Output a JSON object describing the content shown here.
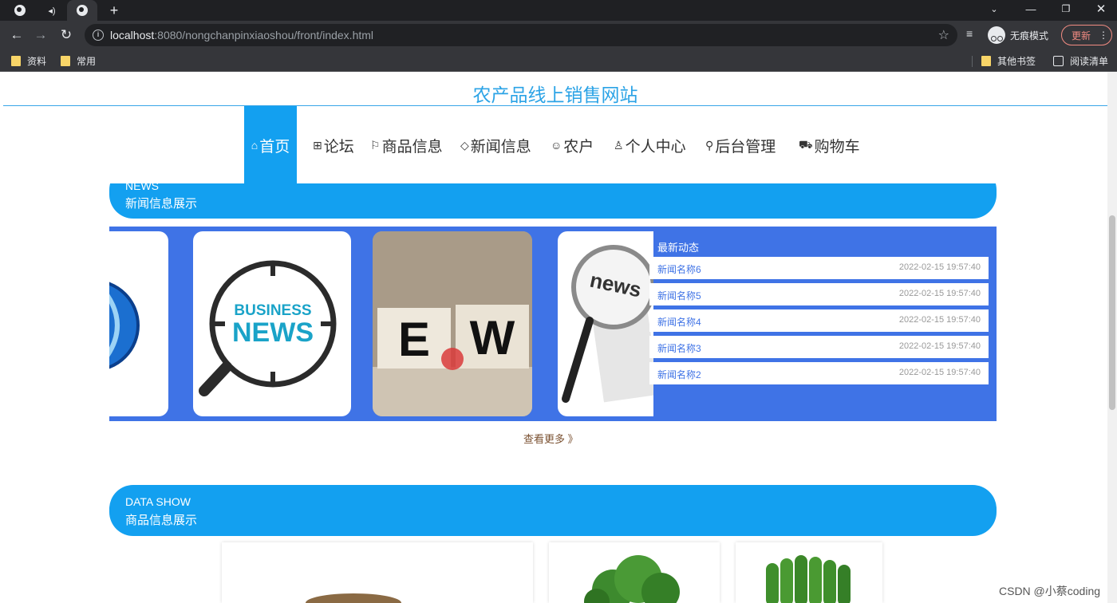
{
  "browser": {
    "url_host": "localhost",
    "url_rest": ":8080/nongchanpinxiaoshou/front/index.html",
    "incognito_label": "无痕模式",
    "update_label": "更新",
    "bookmarks": [
      "资料",
      "常用"
    ],
    "bookmarks_right": [
      "其他书签",
      "阅读清单"
    ]
  },
  "site": {
    "title": "农产品线上销售网站"
  },
  "nav": {
    "items": [
      {
        "icon": "home-icon",
        "label": "首页",
        "active": true
      },
      {
        "icon": "forum-icon",
        "label": "论坛"
      },
      {
        "icon": "flag-icon",
        "label": "商品信息"
      },
      {
        "icon": "tag-icon",
        "label": "新闻信息"
      },
      {
        "icon": "face-icon",
        "label": "农户"
      },
      {
        "icon": "user-icon",
        "label": "个人中心"
      },
      {
        "icon": "link-icon",
        "label": "后台管理"
      },
      {
        "icon": "cart-icon",
        "label": "购物车"
      }
    ]
  },
  "news_section": {
    "en": "NEWS",
    "cn": "新闻信息展示",
    "panel_title": "最新动态",
    "items": [
      {
        "name": "新闻名称6",
        "time": "2022-02-15 19:57:40"
      },
      {
        "name": "新闻名称5",
        "time": "2022-02-15 19:57:40"
      },
      {
        "name": "新闻名称4",
        "time": "2022-02-15 19:57:40"
      },
      {
        "name": "新闻名称3",
        "time": "2022-02-15 19:57:40"
      },
      {
        "name": "新闻名称2",
        "time": "2022-02-15 19:57:40"
      }
    ],
    "images": [
      {
        "text": ""
      },
      {
        "text1": "BUSINESS",
        "text2": "NEWS"
      },
      {
        "letters": [
          "E",
          "W"
        ]
      },
      {
        "text": "news"
      }
    ],
    "more_label": "查看更多 》"
  },
  "data_section": {
    "en": "DATA SHOW",
    "cn": "商品信息展示"
  },
  "watermark": "CSDN @小蔡coding",
  "colors": {
    "accent": "#13a0f0",
    "panel": "#3f73e6",
    "title": "#2ba3e6"
  }
}
